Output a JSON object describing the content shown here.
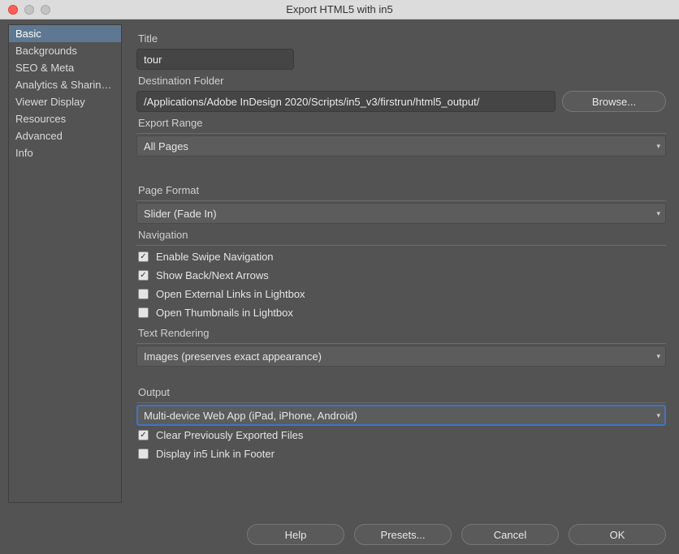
{
  "window_title": "Export HTML5 with in5",
  "sidebar": {
    "items": [
      {
        "label": "Basic",
        "selected": true
      },
      {
        "label": "Backgrounds"
      },
      {
        "label": "SEO & Meta"
      },
      {
        "label": "Analytics & Sharing ..."
      },
      {
        "label": "Viewer Display"
      },
      {
        "label": "Resources"
      },
      {
        "label": "Advanced"
      },
      {
        "label": "Info"
      }
    ]
  },
  "fields": {
    "title_label": "Title",
    "title_value": "tour",
    "dest_label": "Destination Folder",
    "dest_value": "/Applications/Adobe InDesign 2020/Scripts/in5_v3/firstrun/html5_output/",
    "browse_label": "Browse...",
    "export_range_label": "Export Range",
    "export_range_value": "All Pages",
    "page_format_label": "Page Format",
    "page_format_value": "Slider (Fade In)",
    "navigation_label": "Navigation",
    "nav_swipe": "Enable Swipe Navigation",
    "nav_arrows": "Show Back/Next Arrows",
    "nav_ext_lb": "Open External Links in Lightbox",
    "nav_thumb_lb": "Open Thumbnails in Lightbox",
    "text_rendering_label": "Text Rendering",
    "text_rendering_value": "Images (preserves exact appearance)",
    "output_label": "Output",
    "output_value": "Multi-device Web App (iPad, iPhone, Android)",
    "clear_prev": "Clear Previously Exported Files",
    "footer_link": "Display in5 Link in Footer"
  },
  "nav_checks": {
    "swipe": true,
    "arrows": true,
    "ext_lb": false,
    "thumb_lb": false,
    "clear_prev": true,
    "footer_link": false
  },
  "footer": {
    "help": "Help",
    "presets": "Presets...",
    "cancel": "Cancel",
    "ok": "OK"
  }
}
